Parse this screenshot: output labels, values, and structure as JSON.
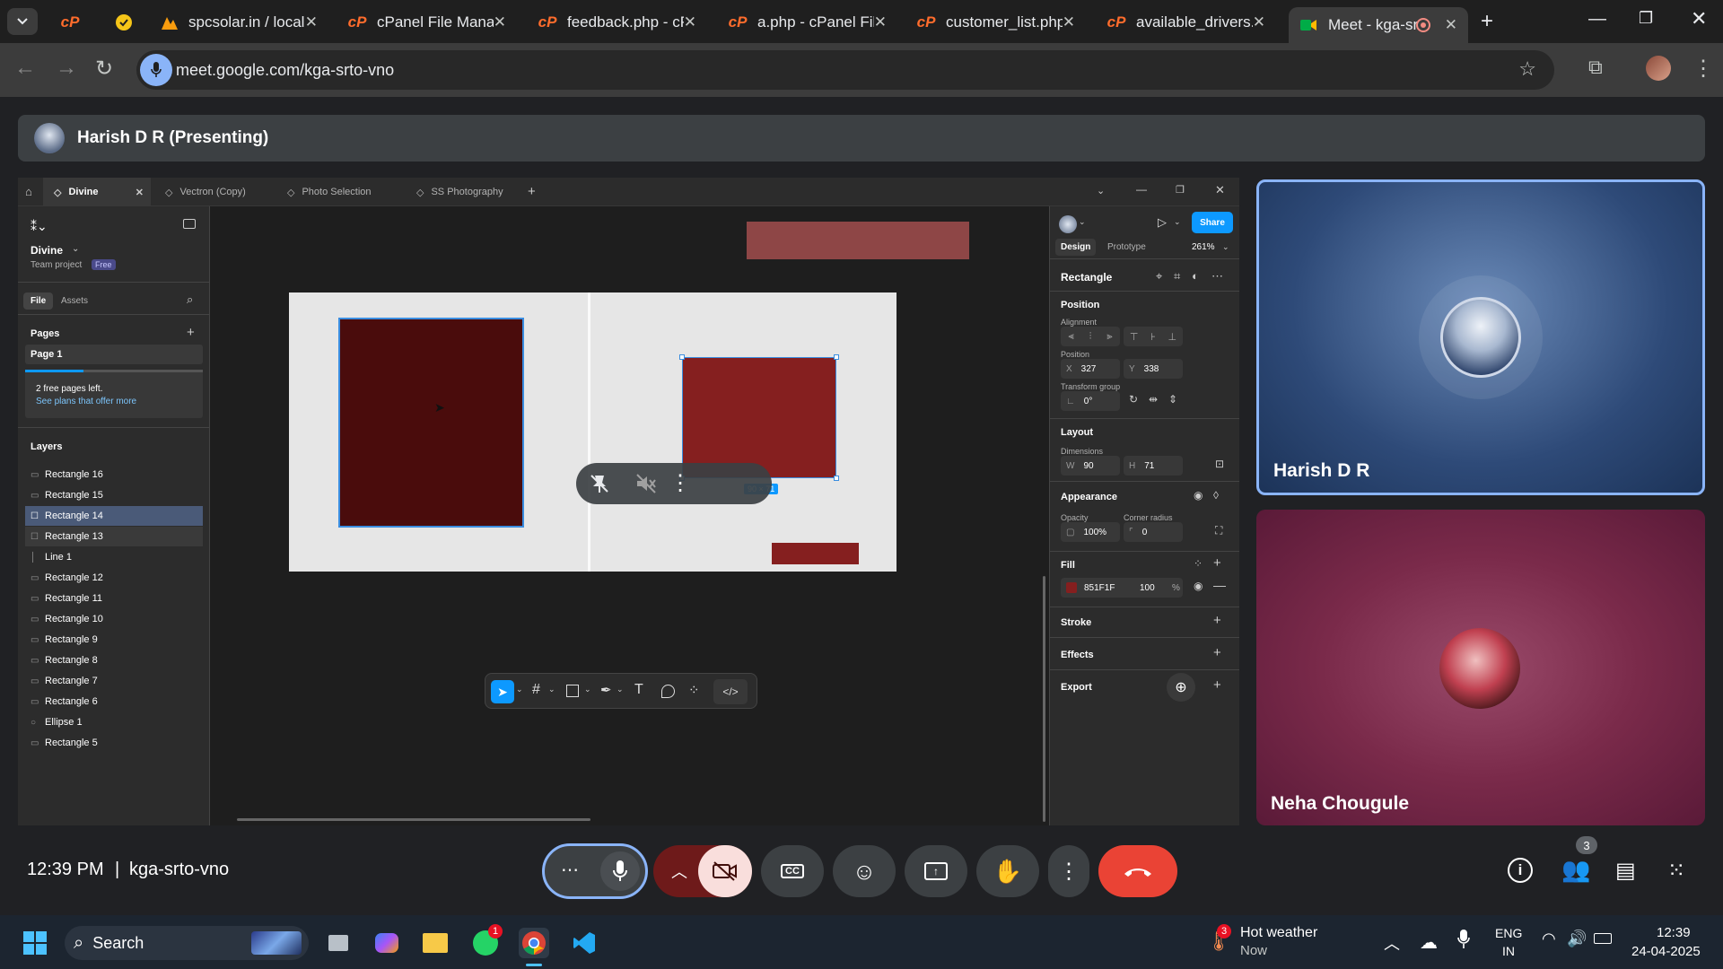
{
  "browser": {
    "tabs": [
      {
        "title": "",
        "icon": "cpanel-icon"
      },
      {
        "title": "",
        "icon": "norton-icon"
      },
      {
        "title": "spcsolar.in / localh",
        "icon": "phpmyadmin-icon"
      },
      {
        "title": "cPanel File Manag",
        "icon": "cpanel-icon"
      },
      {
        "title": "feedback.php - cPa",
        "icon": "cpanel-icon"
      },
      {
        "title": "a.php - cPanel File",
        "icon": "cpanel-icon"
      },
      {
        "title": "customer_list.php",
        "icon": "cpanel-icon"
      },
      {
        "title": "available_drivers.p",
        "icon": "cpanel-icon"
      },
      {
        "title": "Meet - kga-srto",
        "icon": "google-meet-icon",
        "active": true
      }
    ],
    "url": "meet.google.com/kga-srto-vno"
  },
  "meet": {
    "presenting_label": "Harish D R (Presenting)",
    "time": "12:39 PM",
    "meeting_code": "kga-srto-vno",
    "participants_count": "3",
    "tiles": [
      {
        "name": "Harish D R"
      },
      {
        "name": "Neha Chougule"
      }
    ]
  },
  "figma": {
    "tabs": [
      "Divine",
      "Vectron (Copy)",
      "Photo Selection",
      "SS Photography"
    ],
    "file_name": "Divine",
    "team_label": "Team project",
    "plan_badge": "Free",
    "left_tabs": [
      "File",
      "Assets"
    ],
    "pages_label": "Pages",
    "page_1": "Page 1",
    "free_pages_text": "2 free pages left.",
    "see_plans_link": "See plans that offer more",
    "layers_label": "Layers",
    "layers": [
      "Rectangle 16",
      "Rectangle 15",
      "Rectangle 14",
      "Rectangle 13",
      "Line 1",
      "Rectangle 12",
      "Rectangle 11",
      "Rectangle 10",
      "Rectangle 9",
      "Rectangle 8",
      "Rectangle 7",
      "Rectangle 6",
      "Ellipse 1",
      "Rectangle 5"
    ],
    "selection_label": "90 × 71",
    "right": {
      "share": "Share",
      "design_tab": "Design",
      "prototype_tab": "Prototype",
      "zoom": "261%",
      "element_type": "Rectangle",
      "position_section": "Position",
      "alignment_label": "Alignment",
      "position_label": "Position",
      "x_value": "327",
      "y_value": "338",
      "transform_label": "Transform group",
      "rotation": "0°",
      "layout_section": "Layout",
      "dimensions_label": "Dimensions",
      "w_value": "90",
      "h_value": "71",
      "appearance_section": "Appearance",
      "opacity_label": "Opacity",
      "opacity_value": "100%",
      "radius_label": "Corner radius",
      "radius_value": "0",
      "fill_section": "Fill",
      "fill_hex": "851F1F",
      "fill_opacity": "100",
      "fill_pct": "%",
      "stroke_section": "Stroke",
      "effects_section": "Effects",
      "export_section": "Export"
    }
  },
  "taskbar": {
    "search": "Search",
    "weather_title": "Hot weather",
    "weather_sub": "Now",
    "weather_badge": "3",
    "whatsapp_badge": "1",
    "lang": "ENG",
    "region": "IN",
    "clock_time": "12:39",
    "clock_date": "24-04-2025"
  },
  "colors": {
    "fill_color": "#851F1F",
    "dark_rect": "#4a0c0c",
    "end_call": "#ea4335",
    "figma_blue": "#0d99ff"
  }
}
